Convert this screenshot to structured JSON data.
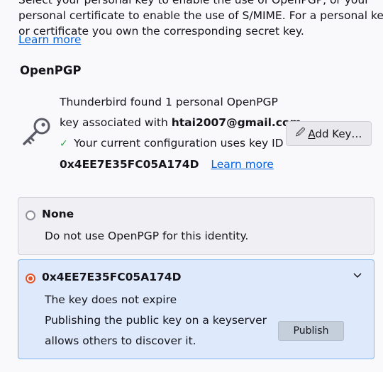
{
  "intro": {
    "line1": "Select your personal key to enable the use of OpenPGP, or your",
    "line2": "personal certificate to enable the use of S/MIME. For a personal key",
    "line3": "or certificate you own the corresponding secret key.",
    "learn_more": "Learn more"
  },
  "openpgp": {
    "title": "OpenPGP",
    "found_line1": "Thunderbird found 1 personal OpenPGP",
    "found_line2_prefix": "key associated with",
    "email": "htai2007@gmail.com",
    "config_text": "Your current configuration uses key ID",
    "key_id": "0x4EE7E35FC05A174D",
    "learn_more": "Learn more",
    "add_key_label": "Add Key…",
    "add_key_mnemonic": "A",
    "add_key_rest": "dd Key…"
  },
  "options": {
    "none": {
      "title": "None",
      "description": "Do not use OpenPGP for this identity."
    },
    "selected": {
      "title": "0x4EE7E35FC05A174D",
      "expiry": "The key does not expire",
      "publish_line1": "Publishing the public key on a keyserver",
      "publish_line2": "allows others to discover it.",
      "publish_label": "Publish"
    }
  },
  "icons": {
    "key": "key-icon",
    "check": "checkmark-icon",
    "pen": "key-pen-icon",
    "chevron": "chevron-down-icon"
  },
  "colors": {
    "link": "#0061e0",
    "accent_radio": "#e0562c",
    "selected_bg": "#deeafc",
    "check": "#2ea44f"
  }
}
